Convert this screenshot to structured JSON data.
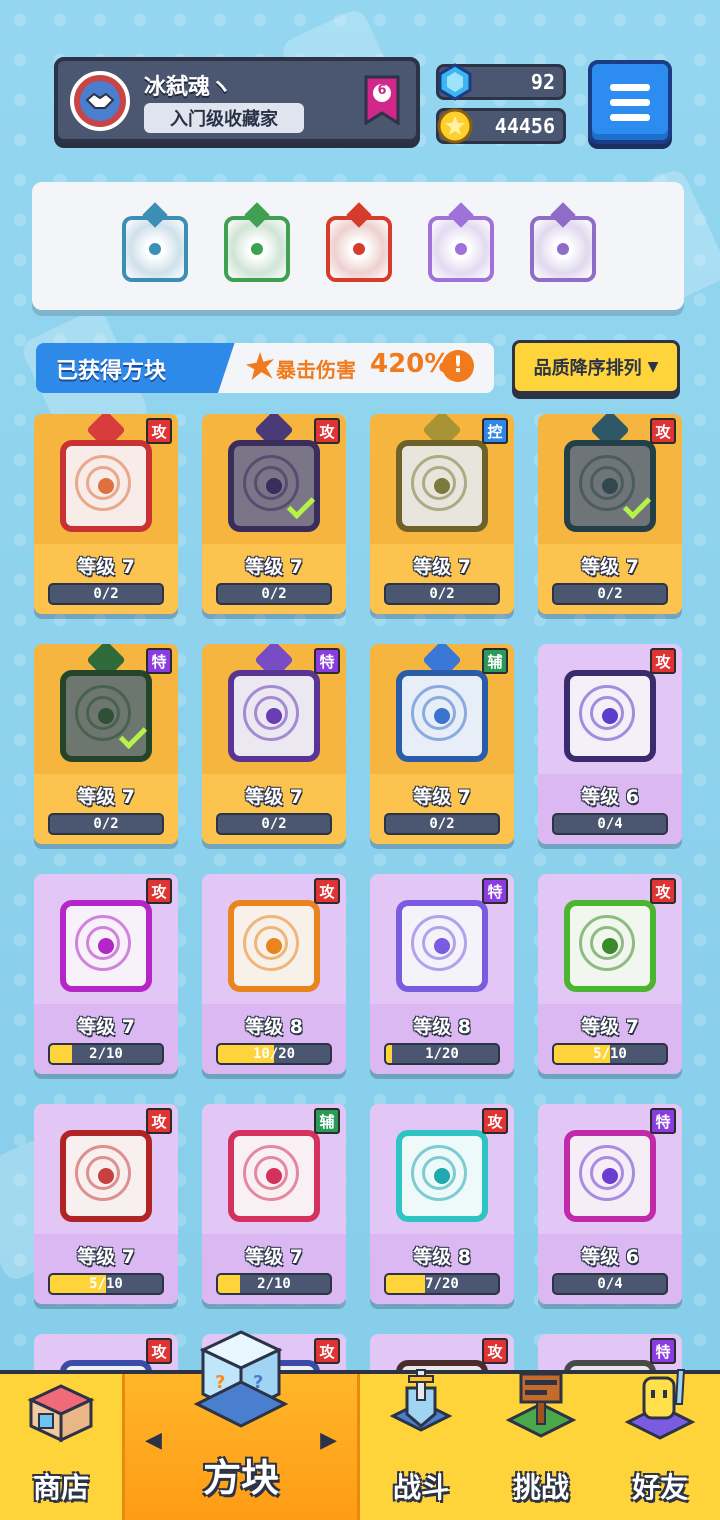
{
  "profile": {
    "name": "冰弑魂ヽ",
    "title": "入门级收藏家",
    "rank": "6"
  },
  "currency": {
    "gems": "92",
    "coins": "44456"
  },
  "equipped": [
    {
      "color": "#3c8fb4",
      "name": "vortex-blue"
    },
    {
      "color": "#3fa052",
      "name": "vortex-green"
    },
    {
      "color": "#d63c2c",
      "name": "flame-red"
    },
    {
      "color": "#9e72d8",
      "name": "vortex-purple"
    },
    {
      "color": "#8f6cc8",
      "name": "vortex-violet"
    }
  ],
  "section": {
    "title": "已获得方块",
    "crit_label": "暴击伤害",
    "crit_value": "420%",
    "info": "!",
    "sort_label": "品质降序排列",
    "sort_arrow": "▼"
  },
  "cards": [
    {
      "tier": "gold",
      "badge": "攻",
      "badge_type": "atk",
      "level": "等级 7",
      "progress": "0/2",
      "fill": 0,
      "frame": "#c93232",
      "art_bg": "#f7ece8",
      "dot": "#e07040",
      "dragon": "#d93c3c",
      "check": false
    },
    {
      "tier": "gold",
      "badge": "攻",
      "badge_type": "atk",
      "level": "等级 7",
      "progress": "0/2",
      "fill": 0,
      "frame": "#3a2c5c",
      "art_bg": "#7a7688",
      "dot": "#3a2c5c",
      "dragon": "#4a3a78",
      "check": true
    },
    {
      "tier": "gold",
      "badge": "控",
      "badge_type": "ctl",
      "level": "等级 7",
      "progress": "0/2",
      "fill": 0,
      "frame": "#6e6228",
      "art_bg": "#e8e6dc",
      "dot": "#7a7a3a",
      "dragon": "#a89434",
      "check": false
    },
    {
      "tier": "gold",
      "badge": "攻",
      "badge_type": "atk",
      "level": "等级 7",
      "progress": "0/2",
      "fill": 0,
      "frame": "#234048",
      "art_bg": "#6e7477",
      "dot": "#30484e",
      "dragon": "#2f5866",
      "check": true
    },
    {
      "tier": "gold",
      "badge": "特",
      "badge_type": "spc",
      "level": "等级 7",
      "progress": "0/2",
      "fill": 0,
      "frame": "#25452a",
      "art_bg": "#6e7670",
      "dot": "#2e5034",
      "dragon": "#2e6a3a",
      "check": true
    },
    {
      "tier": "gold",
      "badge": "特",
      "badge_type": "spc",
      "level": "等级 7",
      "progress": "0/2",
      "fill": 0,
      "frame": "#5a3494",
      "art_bg": "#ece8f2",
      "dot": "#6a3cb4",
      "dragon": "#7a4cc4",
      "check": false
    },
    {
      "tier": "gold",
      "badge": "辅",
      "badge_type": "sup",
      "level": "等级 7",
      "progress": "0/2",
      "fill": 0,
      "frame": "#2a5ca8",
      "art_bg": "#e8eef7",
      "dot": "#3a74d0",
      "dragon": "#3a78d8",
      "check": false
    },
    {
      "tier": "purple",
      "badge": "攻",
      "badge_type": "atk",
      "level": "等级 6",
      "progress": "0/4",
      "fill": 0,
      "frame": "#3a2c6c",
      "art_bg": "#f3f0f8",
      "dot": "#5b3ccc",
      "dragon": "",
      "check": false
    },
    {
      "tier": "purple",
      "badge": "攻",
      "badge_type": "atk",
      "level": "等级 7",
      "progress": "2/10",
      "fill": 0.2,
      "frame": "#b526c8",
      "art_bg": "#f7f2f9",
      "dot": "#b526c8",
      "dragon": "",
      "check": false
    },
    {
      "tier": "purple",
      "badge": "攻",
      "badge_type": "atk",
      "level": "等级 8",
      "progress": "10/20",
      "fill": 0.5,
      "frame": "#e8851f",
      "art_bg": "#f8f1e9",
      "dot": "#e8851f",
      "dragon": "",
      "check": false
    },
    {
      "tier": "purple",
      "badge": "特",
      "badge_type": "spc",
      "level": "等级 8",
      "progress": "1/20",
      "fill": 0.05,
      "frame": "#7a5ce0",
      "art_bg": "#f5f3fa",
      "dot": "#7a5ce0",
      "dragon": "",
      "check": false
    },
    {
      "tier": "purple",
      "badge": "攻",
      "badge_type": "atk",
      "level": "等级 7",
      "progress": "5/10",
      "fill": 0.5,
      "frame": "#4ab52e",
      "art_bg": "#f1f7ee",
      "dot": "#3a8a2a",
      "dragon": "",
      "check": false
    },
    {
      "tier": "purple",
      "badge": "攻",
      "badge_type": "atk",
      "level": "等级 7",
      "progress": "5/10",
      "fill": 0.5,
      "frame": "#b02424",
      "art_bg": "#f8efef",
      "dot": "#c84040",
      "dragon": "",
      "check": false
    },
    {
      "tier": "purple",
      "badge": "辅",
      "badge_type": "sup",
      "level": "等级 7",
      "progress": "2/10",
      "fill": 0.2,
      "frame": "#d4325c",
      "art_bg": "#f9f0f3",
      "dot": "#d4325c",
      "dragon": "",
      "check": false
    },
    {
      "tier": "purple",
      "badge": "攻",
      "badge_type": "atk",
      "level": "等级 8",
      "progress": "7/20",
      "fill": 0.35,
      "frame": "#2ec4c4",
      "art_bg": "#eef9f9",
      "dot": "#1fa8b0",
      "dragon": "",
      "check": false
    },
    {
      "tier": "purple",
      "badge": "特",
      "badge_type": "spc",
      "level": "等级 6",
      "progress": "0/4",
      "fill": 0,
      "frame": "#c02aa8",
      "art_bg": "#f5eef6",
      "dot": "#6a3cd0",
      "dragon": "",
      "check": false
    },
    {
      "tier": "purple",
      "badge": "攻",
      "badge_type": "atk",
      "level": "",
      "progress": "",
      "fill": 0,
      "frame": "#3a4ca8",
      "art_bg": "#eef0f7",
      "dot": "#3a4ca8",
      "dragon": "",
      "check": false
    },
    {
      "tier": "purple",
      "badge": "攻",
      "badge_type": "atk",
      "level": "",
      "progress": "",
      "fill": 0,
      "frame": "#3a4ca8",
      "art_bg": "#eef0f7",
      "dot": "#3a4ca8",
      "dragon": "",
      "check": false
    },
    {
      "tier": "purple",
      "badge": "攻",
      "badge_type": "atk",
      "level": "",
      "progress": "",
      "fill": 0,
      "frame": "#4a2c2c",
      "art_bg": "#ece8e8",
      "dot": "#4a2c2c",
      "dragon": "",
      "check": false
    },
    {
      "tier": "purple",
      "badge": "特",
      "badge_type": "spc",
      "level": "",
      "progress": "",
      "fill": 0,
      "frame": "#4a4a4a",
      "art_bg": "#e8e8e8",
      "dot": "#4a4a4a",
      "dragon": "",
      "check": false
    }
  ],
  "nav": {
    "shop": "商店",
    "blocks": "方块",
    "battle": "战斗",
    "challenge": "挑战",
    "friends": "好友",
    "left_arrow": "◀",
    "right_arrow": "▶",
    "block_glyph": "?"
  }
}
